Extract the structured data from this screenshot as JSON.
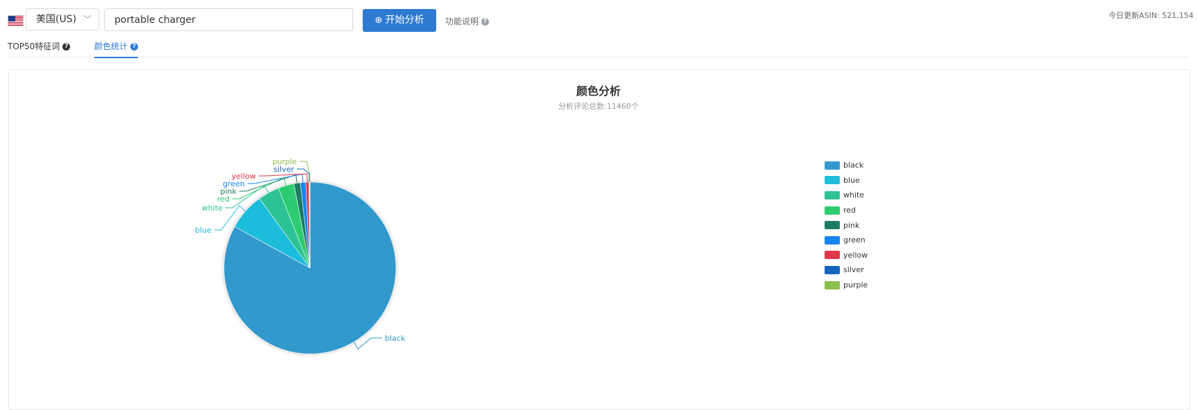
{
  "topbar": {
    "country": "美国(US)",
    "search_value": "portable charger",
    "search_placeholder": "",
    "analyze_label": "开始分析",
    "help_label": "功能说明",
    "update_info": "今日更新ASIN: 521,154"
  },
  "tabs": [
    {
      "label": "TOP50特征词",
      "active": false
    },
    {
      "label": "颜色统计",
      "active": true
    }
  ],
  "chart_data": {
    "type": "pie",
    "title": "颜色分析",
    "subtitle": "分析评论总数:11460个",
    "total_reviews": 11460,
    "slices": [
      {
        "name": "black",
        "value": 83.0,
        "color": "#3399cc"
      },
      {
        "name": "blue",
        "value": 7.0,
        "color": "#1fbddb"
      },
      {
        "name": "white",
        "value": 4.0,
        "color": "#2ec297"
      },
      {
        "name": "red",
        "value": 3.0,
        "color": "#2ecc71"
      },
      {
        "name": "pink",
        "value": 1.2,
        "color": "#1e7b64"
      },
      {
        "name": "green",
        "value": 1.0,
        "color": "#1684ef"
      },
      {
        "name": "yellow",
        "value": 0.6,
        "color": "#e0374a"
      },
      {
        "name": "silver",
        "value": 0.1,
        "color": "#1565c0"
      },
      {
        "name": "purple",
        "value": 0.1,
        "color": "#8cbf4c"
      }
    ],
    "legend_position": "right"
  }
}
